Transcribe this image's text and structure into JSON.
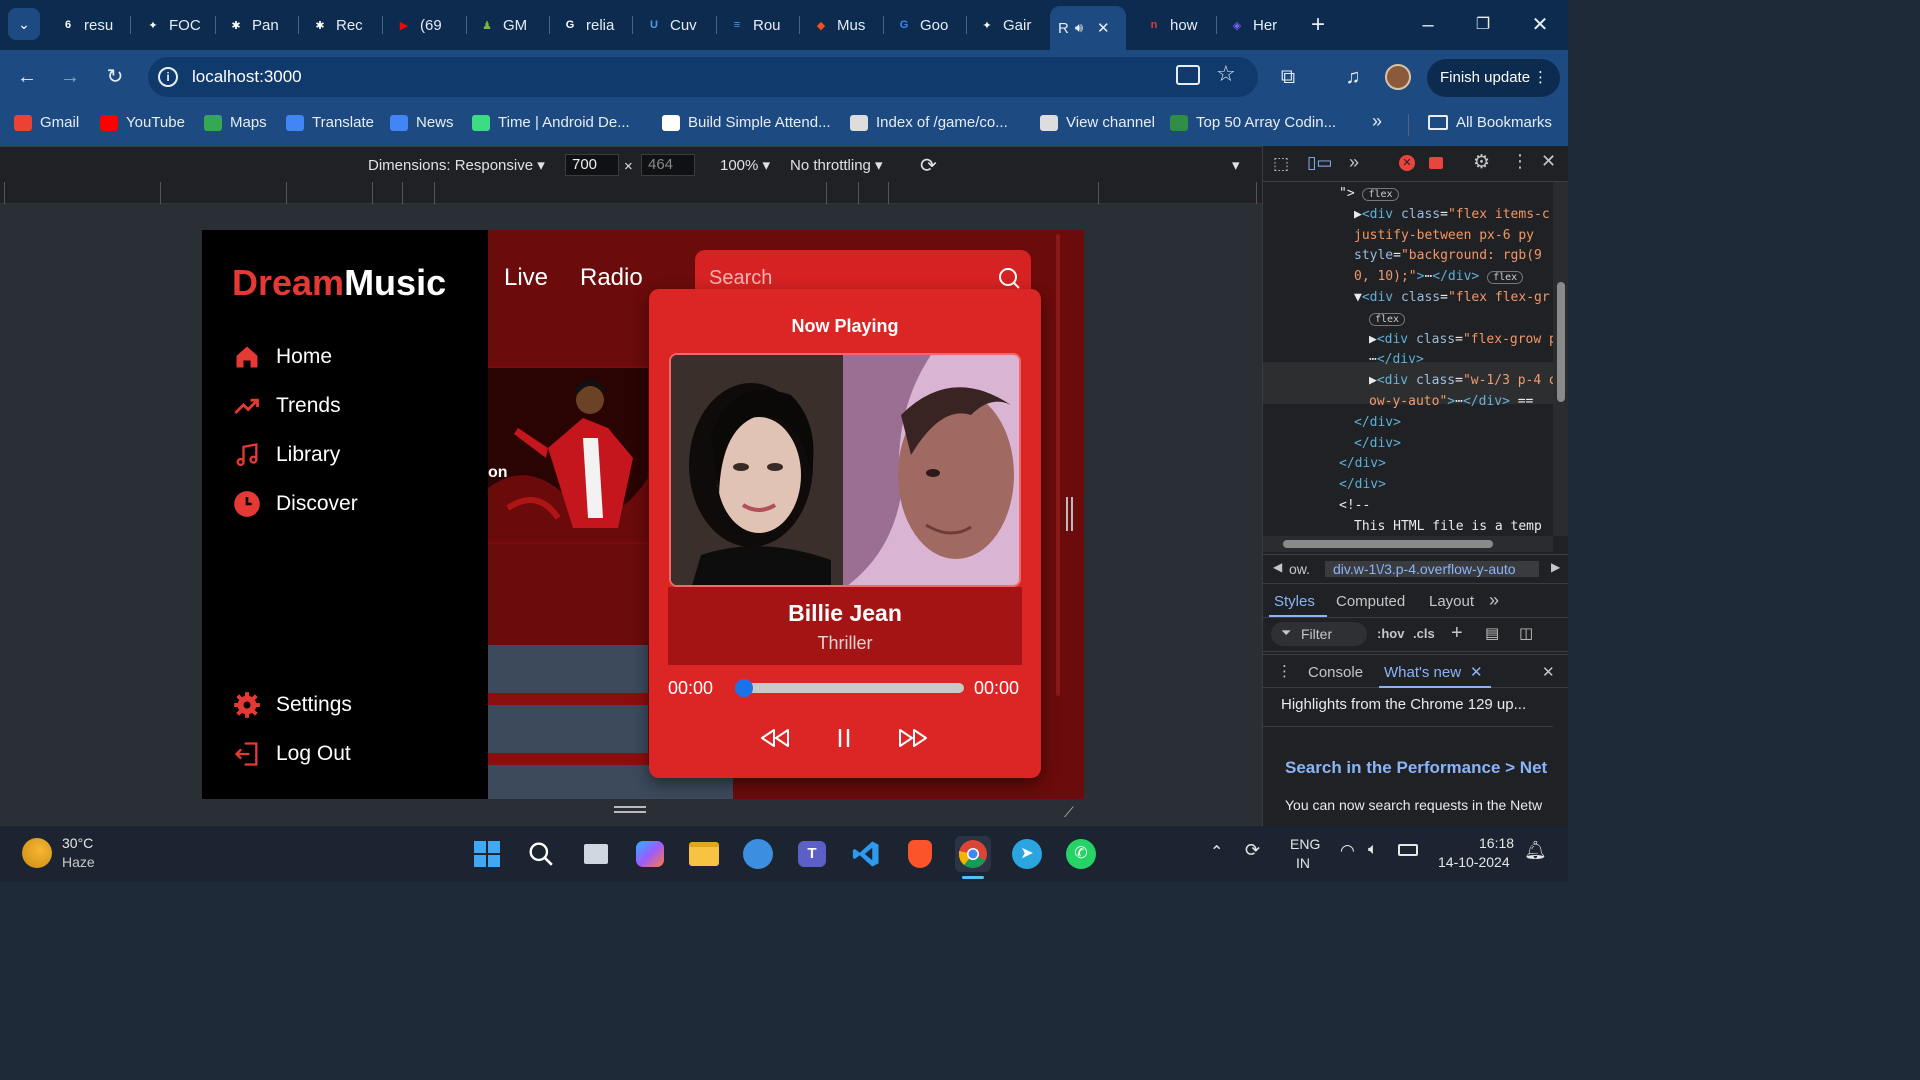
{
  "browser": {
    "tabs": [
      {
        "label": "resu",
        "color": "#ffffff",
        "glyph": "6"
      },
      {
        "label": "FOC",
        "color": "#ffffff",
        "glyph": "✦"
      },
      {
        "label": "Pan",
        "color": "#ffffff",
        "glyph": "✱"
      },
      {
        "label": "Rec",
        "color": "#ffffff",
        "glyph": "✱"
      },
      {
        "label": "(69",
        "color": "#ff0000",
        "glyph": "▶"
      },
      {
        "label": "GM",
        "color": "#7cb342",
        "glyph": "♟"
      },
      {
        "label": "relia",
        "color": "#ffffff",
        "glyph": "G"
      },
      {
        "label": "Cuv",
        "color": "#4a9be8",
        "glyph": "U"
      },
      {
        "label": "Rou",
        "color": "#4a9be8",
        "glyph": "≡"
      },
      {
        "label": "Mus",
        "color": "#f24e1e",
        "glyph": "◆"
      },
      {
        "label": "Goo",
        "color": "#4285f4",
        "glyph": "G"
      },
      {
        "label": "Gair",
        "color": "#ffffff",
        "glyph": "✦"
      },
      {
        "label": "R",
        "color": "#1d4a80",
        "glyph": ""
      },
      {
        "label": "how",
        "color": "#e53935",
        "glyph": "n"
      },
      {
        "label": "Her",
        "color": "#7b61ff",
        "glyph": "◈"
      }
    ],
    "url": "localhost:3000",
    "finish_update": "Finish update",
    "bookmarks": [
      {
        "label": "Gmail",
        "color": "#ea4335"
      },
      {
        "label": "YouTube",
        "color": "#ff0000"
      },
      {
        "label": "Maps",
        "color": "#34a853"
      },
      {
        "label": "Translate",
        "color": "#4285f4"
      },
      {
        "label": "News",
        "color": "#4285f4"
      },
      {
        "label": "Time  |  Android De...",
        "color": "#3ddc84"
      },
      {
        "label": "Build Simple Attend...",
        "color": "#ffffff"
      },
      {
        "label": "Index of /game/co...",
        "color": "#dddddd"
      },
      {
        "label": "View channel",
        "color": "#dddddd"
      },
      {
        "label": "Top 50 Array Codin...",
        "color": "#2f8d46"
      }
    ],
    "bookmarks_more": "»",
    "all_bookmarks": "All Bookmarks"
  },
  "device_toolbar": {
    "dimensions": "Dimensions: Responsive",
    "width": "700",
    "height": "464",
    "zoom": "100%",
    "throttling": "No throttling"
  },
  "app": {
    "logo_a": "Dream",
    "logo_b": "Music",
    "nav": [
      {
        "label": "Home",
        "icon": "home-icon"
      },
      {
        "label": "Trends",
        "icon": "trend-icon"
      },
      {
        "label": "Library",
        "icon": "music-note-icon"
      },
      {
        "label": "Discover",
        "icon": "clock-icon"
      }
    ],
    "nav_bottom": [
      {
        "label": "Settings",
        "icon": "gear-icon"
      },
      {
        "label": "Log Out",
        "icon": "logout-icon"
      }
    ],
    "top_links": [
      "Live",
      "Radio"
    ],
    "search_placeholder": "Search",
    "hero_caption": "on",
    "player": {
      "heading": "Now Playing",
      "song": "Billie Jean",
      "album": "Thriller",
      "time_current": "00:00",
      "time_total": "00:00",
      "progress": 0
    },
    "accent": "#dc2626"
  },
  "devtools": {
    "dom_lines": [
      {
        "indent": 0,
        "html": "\"> <span class='pill'>flex</span>"
      },
      {
        "indent": 1,
        "html": "▶<span class='tag'>&lt;div</span> <span class='attr'>class</span>=<span class='val'>\"flex items-c</span>"
      },
      {
        "indent": 1,
        "html": "<span class='val'>justify-between px-6  py</span>"
      },
      {
        "indent": 1,
        "html": "<span class='attr'>style</span>=<span class='val'>\"background: rgb(9</span>"
      },
      {
        "indent": 1,
        "html": "<span class='val'>0, 10);\"</span><span class='tag'>&gt;</span>⋯<span class='tag'>&lt;/div&gt;</span> <span class='pill'>flex</span>"
      },
      {
        "indent": 1,
        "html": "▼<span class='tag'>&lt;div</span> <span class='attr'>class</span>=<span class='val'>\"flex flex-gr</span>"
      },
      {
        "indent": 2,
        "html": "<span class='pill'>flex</span>"
      },
      {
        "indent": 2,
        "html": "▶<span class='tag'>&lt;div</span> <span class='attr'>class</span>=<span class='val'>\"flex-grow p</span>"
      },
      {
        "indent": 2,
        "html": "⋯<span class='tag'>&lt;/div&gt;</span>"
      },
      {
        "indent": 2,
        "html": "▶<span class='tag'>&lt;div</span> <span class='attr'>class</span>=<span class='val'>\"w-1/3 p-4 o</span>"
      },
      {
        "indent": 2,
        "html": "<span class='val'>ow-y-auto\"</span><span class='tag'>&gt;</span>⋯<span class='tag'>&lt;/div&gt;</span> =="
      },
      {
        "indent": 1,
        "html": "<span class='tag'>&lt;/div&gt;</span>"
      },
      {
        "indent": 1,
        "html": "<span class='tag'>&lt;/div&gt;</span>"
      },
      {
        "indent": 0,
        "html": "<span class='tag'>&lt;/div&gt;</span>"
      },
      {
        "indent": 0,
        "html": "<span class='tag'>&lt;/div&gt;</span>"
      },
      {
        "indent": 0,
        "html": "&lt;!--"
      },
      {
        "indent": 1,
        "html": "This HTML file is a temp"
      }
    ],
    "breadcrumb_prev": "ow.",
    "breadcrumb": "div.w-1\\/3.p-4.overflow-y-auto",
    "style_tabs": [
      "Styles",
      "Computed",
      "Layout"
    ],
    "filter": "Filter",
    "hov": ":hov",
    "cls": ".cls",
    "drawer_tabs": [
      "Console",
      "What's new"
    ],
    "highlights": "Highlights from the Chrome 129 up...",
    "whatsnew_title": "Search in the Performance > Net",
    "whatsnew_body": "You can now search requests in the Netw"
  },
  "taskbar": {
    "temp": "30°C",
    "weather": "Haze",
    "lang1": "ENG",
    "lang2": "IN",
    "time": "16:18",
    "date": "14-10-2024"
  }
}
